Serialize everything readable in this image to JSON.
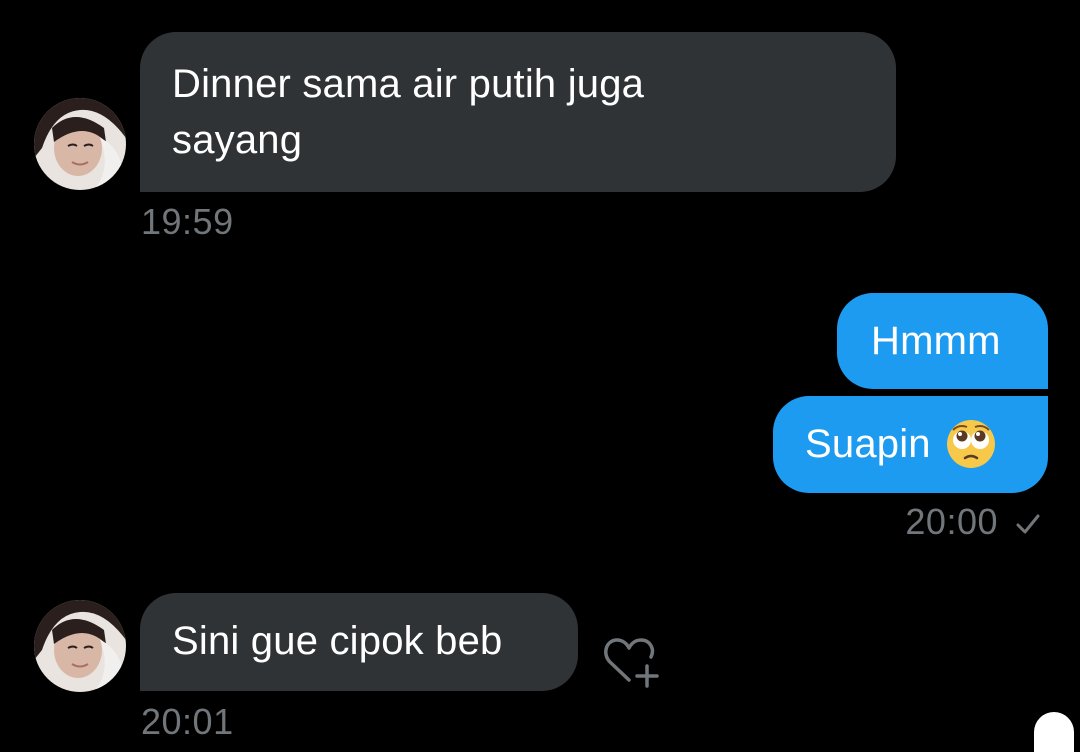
{
  "conversation": {
    "messages": [
      {
        "direction": "incoming",
        "text_line1": "Dinner sama air putih juga",
        "text_line2": "sayang",
        "time": "19:59"
      },
      {
        "direction": "outgoing",
        "text": "Hmmm"
      },
      {
        "direction": "outgoing",
        "text": "Suapin",
        "emoji": "pleading-face-emoji",
        "time": "20:00",
        "status": "sent-check"
      },
      {
        "direction": "incoming",
        "text": "Sini gue cipok beb",
        "time": "20:01",
        "reaction_button": "add-reaction-heart-icon"
      }
    ]
  },
  "colors": {
    "background": "#000000",
    "incoming_bubble": "#2f3336",
    "outgoing_bubble": "#1d9bf0",
    "timestamp": "#71767b"
  }
}
